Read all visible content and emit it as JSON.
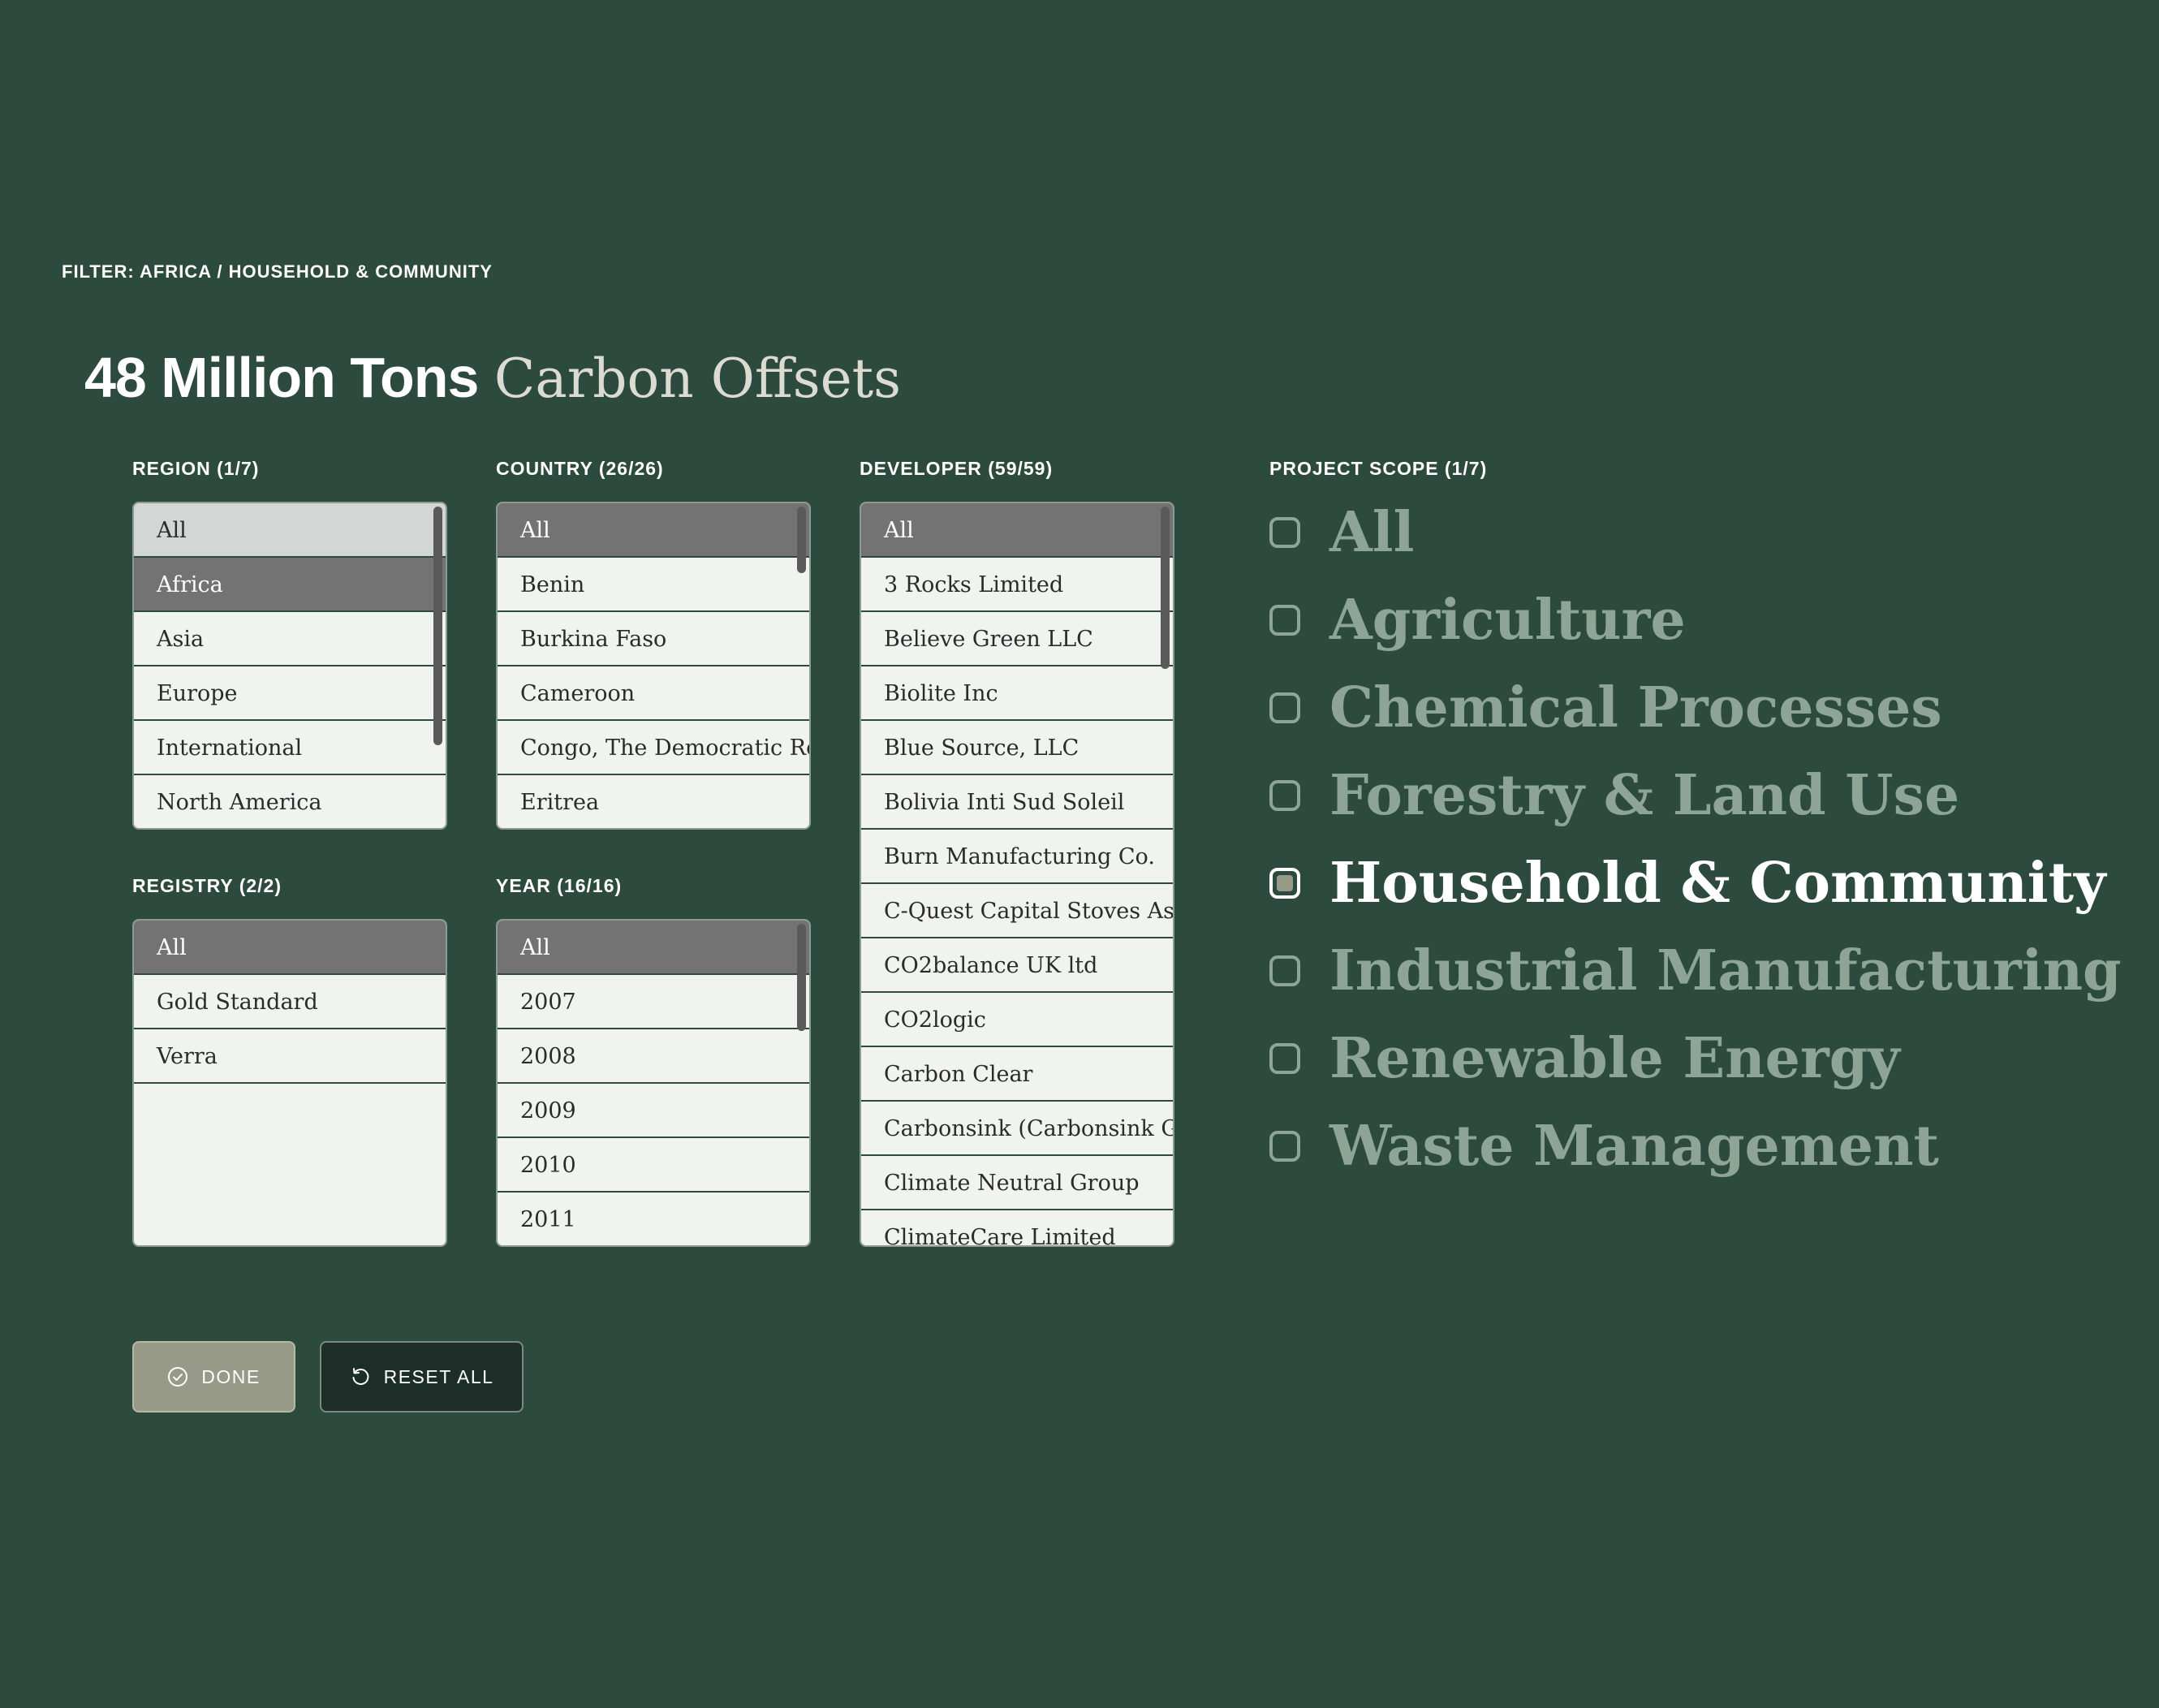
{
  "breadcrumb": "FILTER: AFRICA / HOUSEHOLD & COMMUNITY",
  "headline": {
    "amount": "48 Million Tons",
    "label": "Carbon Offsets"
  },
  "region": {
    "label": "REGION (1/7)",
    "items": [
      "All",
      "Africa",
      "Asia",
      "Europe",
      "International",
      "North America"
    ]
  },
  "country": {
    "label": "COUNTRY (26/26)",
    "items": [
      "All",
      "Benin",
      "Burkina Faso",
      "Cameroon",
      "Congo, The Democratic Republic",
      "Eritrea"
    ]
  },
  "developer": {
    "label": "DEVELOPER (59/59)",
    "items": [
      "All",
      "3 Rocks Limited",
      "Believe Green LLC",
      "Biolite Inc",
      "Blue Source, LLC",
      "Bolivia Inti Sud Soleil",
      "Burn Manufacturing Co.",
      "C-Quest Capital Stoves Asia Pvt",
      "CO2balance UK ltd",
      "CO2logic",
      "Carbon Clear",
      "Carbonsink (Carbonsink Group)",
      "Climate Neutral Group",
      "ClimateCare Limited"
    ]
  },
  "registry": {
    "label": "REGISTRY (2/2)",
    "items": [
      "All",
      "Gold Standard",
      "Verra"
    ]
  },
  "year": {
    "label": "YEAR (16/16)",
    "items": [
      "All",
      "2007",
      "2008",
      "2009",
      "2010",
      "2011"
    ]
  },
  "project_scope": {
    "label": "PROJECT SCOPE (1/7)",
    "items": [
      "All",
      "Agriculture",
      "Chemical Processes",
      "Forestry & Land Use",
      "Household & Community",
      "Industrial Manufacturing",
      "Renewable Energy",
      "Waste Management"
    ],
    "checked": "Household & Community"
  },
  "buttons": {
    "done": "DONE",
    "reset": "RESET ALL"
  },
  "colors": {
    "background": "#2d4a3e",
    "list_bg": "#f1f3ef",
    "selected_row": "#737373",
    "scope_muted": "#8ea497",
    "done_button": "#979a86",
    "reset_button": "#1c2e27"
  }
}
